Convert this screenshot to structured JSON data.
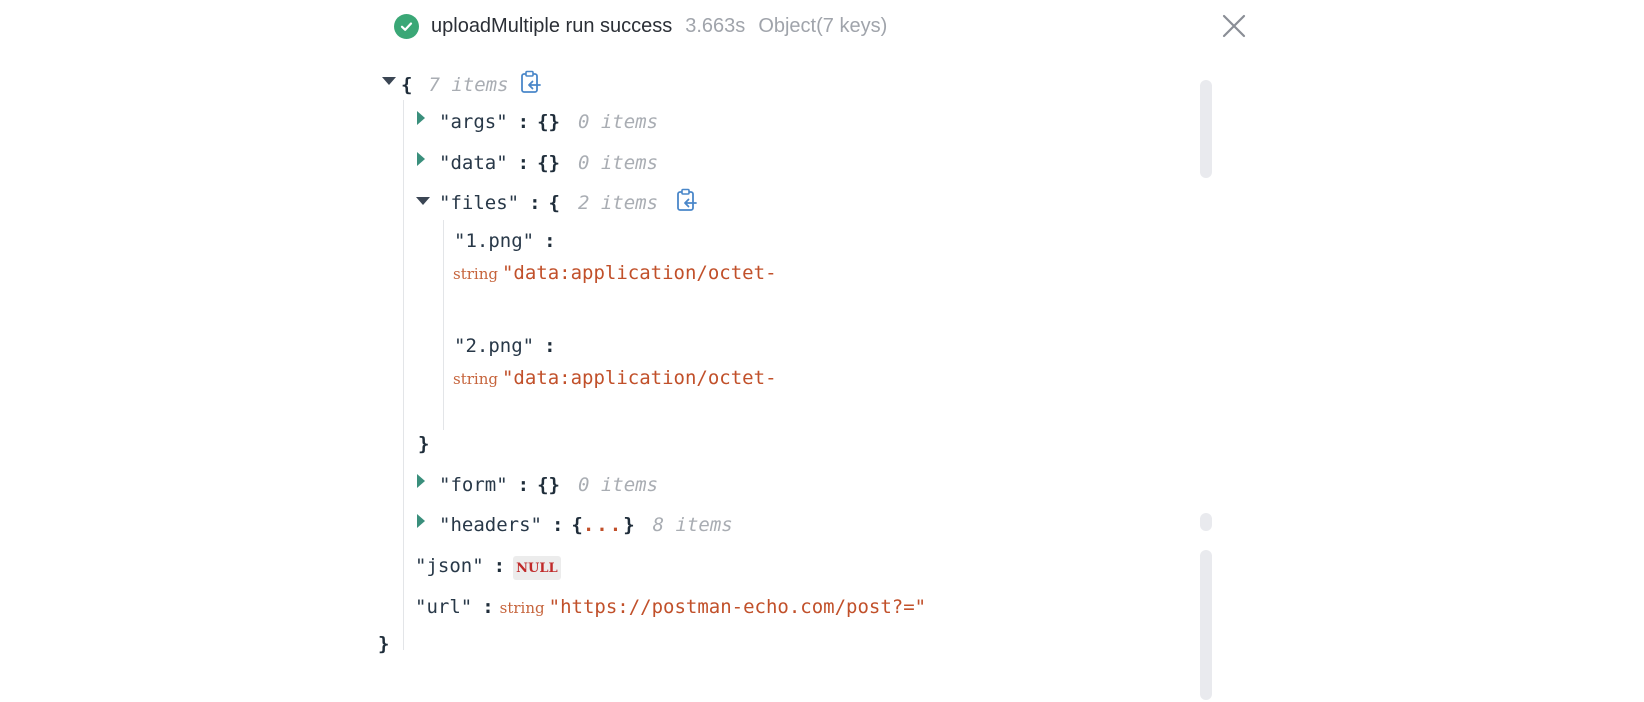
{
  "header": {
    "status_icon": "check-circle-icon",
    "title": "uploadMultiple run success",
    "time": "3.663s",
    "summary": "Object(7 keys)",
    "close_icon": "close-icon"
  },
  "colors": {
    "success": "#3aa776",
    "key": "#283848",
    "string": "#c1502a",
    "count": "#a9adb3",
    "expander_collapsed": "#3a8f7c",
    "null_text": "#c02a2a"
  },
  "tree": {
    "root": {
      "open": "{",
      "count": "7 items",
      "close": "}"
    },
    "args": {
      "key": "\"args\"",
      "colon": ":",
      "value": "{}",
      "count": "0 items"
    },
    "data": {
      "key": "\"data\"",
      "colon": ":",
      "value": "{}",
      "count": "0 items"
    },
    "files": {
      "key": "\"files\"",
      "colon": ":",
      "open": "{",
      "count": "2 items",
      "close": "}",
      "entries": [
        {
          "key": "\"1.png\"",
          "colon": ":",
          "type": "string",
          "value": "\"data:application/octet-"
        },
        {
          "key": "\"2.png\"",
          "colon": ":",
          "type": "string",
          "value": "\"data:application/octet-"
        }
      ]
    },
    "form": {
      "key": "\"form\"",
      "colon": ":",
      "value": "{}",
      "count": "0 items"
    },
    "headers": {
      "key": "\"headers\"",
      "colon": ":",
      "open": "{",
      "ellipsis": "...",
      "close": "}",
      "count": "8 items"
    },
    "json": {
      "key": "\"json\"",
      "colon": ":",
      "value": "NULL"
    },
    "url": {
      "key": "\"url\"",
      "colon": ":",
      "type": "string",
      "value": "\"https://postman-echo.com/post?=\""
    }
  }
}
